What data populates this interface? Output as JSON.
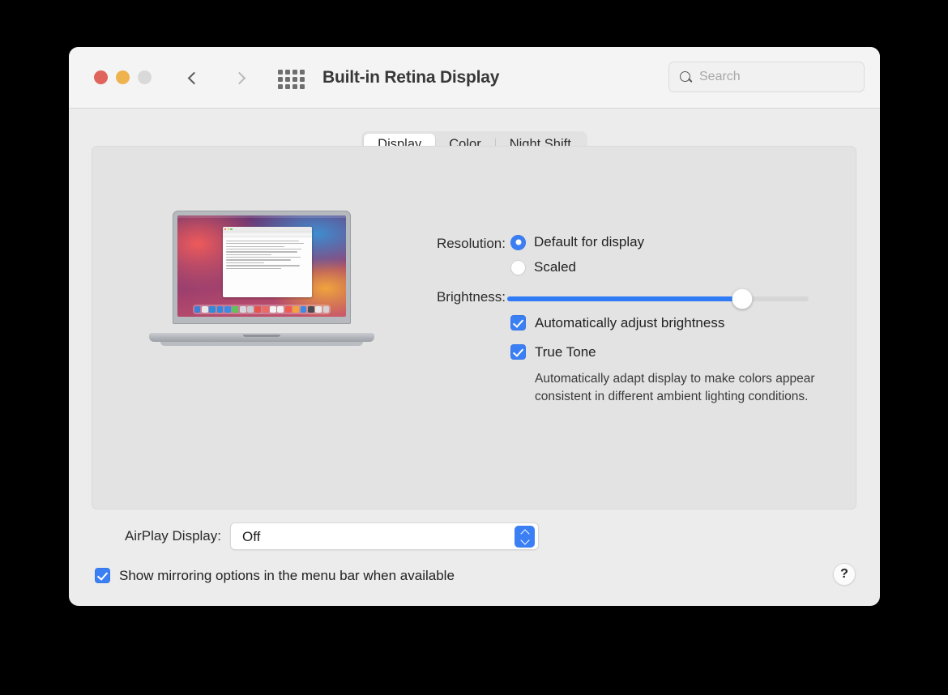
{
  "window": {
    "title": "Built-in Retina Display",
    "traffic_lights": [
      {
        "name": "close",
        "color": "#e0635c"
      },
      {
        "name": "minimize",
        "color": "#eeb34f"
      },
      {
        "name": "zoom",
        "color": "#d9d9d9"
      }
    ],
    "nav": {
      "back_label": "Back",
      "forward_label": "Forward"
    },
    "show_all_label": "Show All",
    "search": {
      "placeholder": "Search",
      "value": "",
      "icon": "search-icon"
    }
  },
  "tabs": [
    {
      "label": "Display",
      "selected": true
    },
    {
      "label": "Color",
      "selected": false
    },
    {
      "label": "Night Shift",
      "selected": false
    }
  ],
  "preview": {
    "device": "MacBook Pro",
    "dock_icon_colors": [
      "#3f7fd6",
      "#e8e8ea",
      "#2d8bd8",
      "#2e8ae0",
      "#3d8ae6",
      "#62c15a",
      "#d8d8dc",
      "#c9cbd0",
      "#e5554b",
      "#eb6a61",
      "#f3f3f3",
      "#f0f0f0",
      "#ef5b4e",
      "#f2a23e",
      "#3d8ae6",
      "#4a4a4f",
      "#e9e9ec",
      "#d4d4d8"
    ]
  },
  "settings": {
    "resolution": {
      "label": "Resolution:",
      "options": [
        {
          "label": "Default for display",
          "selected": true
        },
        {
          "label": "Scaled",
          "selected": false
        }
      ]
    },
    "brightness": {
      "label": "Brightness:",
      "value_percent": 78
    },
    "auto_brightness": {
      "label": "Automatically adjust brightness",
      "checked": true
    },
    "true_tone": {
      "label": "True Tone",
      "checked": true,
      "description": "Automatically adapt display to make colors appear consistent in different ambient lighting conditions."
    }
  },
  "bottom": {
    "airplay": {
      "label": "AirPlay Display:",
      "value": "Off"
    },
    "mirroring": {
      "label": "Show mirroring options in the menu bar when available",
      "checked": true
    },
    "help_label": "?"
  },
  "colors": {
    "accent": "#3b7ff5",
    "slider_fill": "#2f7cf6",
    "window_bg": "#ececec",
    "toolbar_bg": "#f4f4f4",
    "panel_bg": "#e3e3e3"
  }
}
